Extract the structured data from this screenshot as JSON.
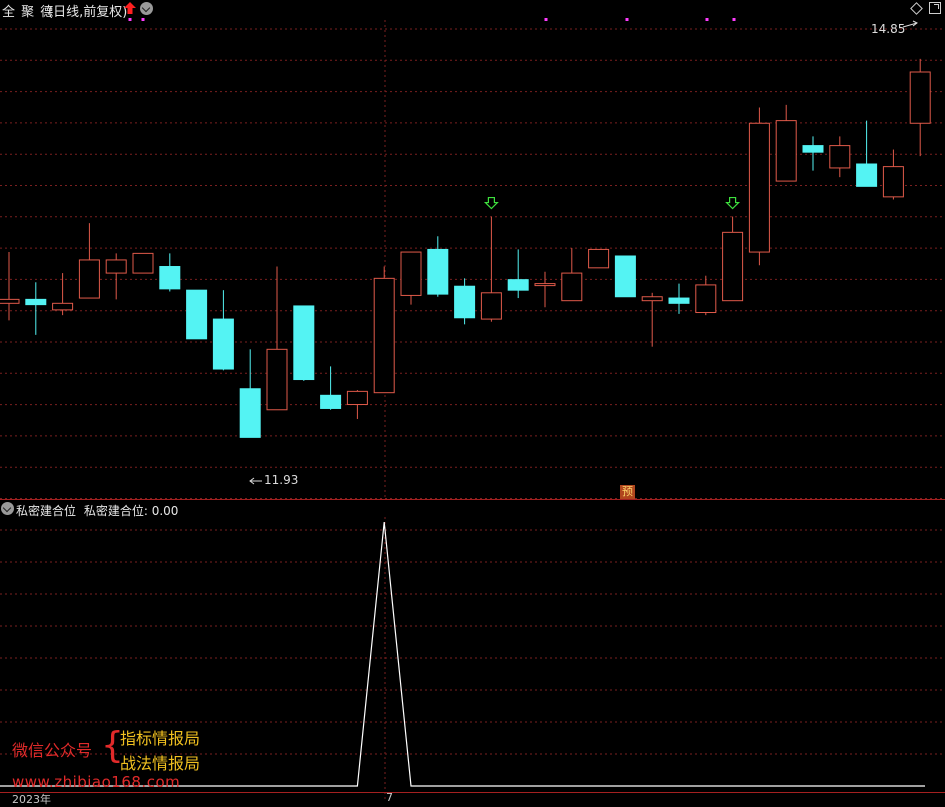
{
  "header": {
    "stock_name": "全 聚 德",
    "period": "(日线,前复权)",
    "colors": {
      "up": "#e05a4a",
      "down": "#54f3f3",
      "grid": "#7a1f1f",
      "axis": "#a52020"
    }
  },
  "price_panel": {
    "high_label": "14.85",
    "low_label": "11.93",
    "prediction_badge": "预"
  },
  "indicator": {
    "name": "私密建合位",
    "value_label": "私密建合位: 0.00"
  },
  "watermark": {
    "account": "微信公众号",
    "brace": "{",
    "line1": "指标情报局",
    "line2": "战法情报局",
    "url": "www.zhibiao168.com"
  },
  "x_axis": {
    "year_label": "2023年",
    "month_label": "7"
  },
  "chart_data": {
    "type": "candlestick",
    "price_range": [
      11.6,
      15.1
    ],
    "candles": [
      {
        "o": 12.99,
        "h": 13.38,
        "l": 12.86,
        "c": 13.02
      },
      {
        "o": 13.02,
        "h": 13.15,
        "l": 12.75,
        "c": 12.98
      },
      {
        "o": 12.94,
        "h": 13.22,
        "l": 12.9,
        "c": 12.99
      },
      {
        "o": 13.03,
        "h": 13.6,
        "l": 13.03,
        "c": 13.32
      },
      {
        "o": 13.22,
        "h": 13.37,
        "l": 13.02,
        "c": 13.32
      },
      {
        "o": 13.22,
        "h": 13.37,
        "l": 13.22,
        "c": 13.37
      },
      {
        "o": 13.27,
        "h": 13.37,
        "l": 13.08,
        "c": 13.1
      },
      {
        "o": 13.09,
        "h": 13.09,
        "l": 12.72,
        "c": 12.72
      },
      {
        "o": 12.87,
        "h": 13.09,
        "l": 12.48,
        "c": 12.49
      },
      {
        "o": 12.34,
        "h": 12.64,
        "l": 11.97,
        "c": 11.97
      },
      {
        "o": 12.18,
        "h": 13.27,
        "l": 12.18,
        "c": 12.64
      },
      {
        "o": 12.97,
        "h": 12.97,
        "l": 12.4,
        "c": 12.41
      },
      {
        "o": 12.29,
        "h": 12.51,
        "l": 12.18,
        "c": 12.19
      },
      {
        "o": 12.22,
        "h": 12.33,
        "l": 12.11,
        "c": 12.32
      },
      {
        "o": 12.31,
        "h": 13.27,
        "l": 12.31,
        "c": 13.18
      },
      {
        "o": 13.05,
        "h": 13.38,
        "l": 12.98,
        "c": 13.38
      },
      {
        "o": 13.4,
        "h": 13.5,
        "l": 13.04,
        "c": 13.06
      },
      {
        "o": 13.12,
        "h": 13.18,
        "l": 12.83,
        "c": 12.88
      },
      {
        "o": 12.87,
        "h": 13.65,
        "l": 12.85,
        "c": 13.07
      },
      {
        "o": 13.17,
        "h": 13.4,
        "l": 13.03,
        "c": 13.09
      },
      {
        "o": 13.14,
        "h": 13.23,
        "l": 12.96,
        "c": 13.14
      },
      {
        "o": 13.01,
        "h": 13.41,
        "l": 13.01,
        "c": 13.22
      },
      {
        "o": 13.26,
        "h": 13.37,
        "l": 13.26,
        "c": 13.4
      },
      {
        "o": 13.35,
        "h": 13.35,
        "l": 13.04,
        "c": 13.04
      },
      {
        "o": 13.01,
        "h": 13.07,
        "l": 12.66,
        "c": 13.04
      },
      {
        "o": 13.03,
        "h": 13.14,
        "l": 12.91,
        "c": 12.99
      },
      {
        "o": 12.92,
        "h": 13.2,
        "l": 12.9,
        "c": 13.13
      },
      {
        "o": 13.01,
        "h": 13.65,
        "l": 13.01,
        "c": 13.53
      },
      {
        "o": 13.38,
        "h": 14.48,
        "l": 13.28,
        "c": 14.36
      },
      {
        "o": 13.92,
        "h": 14.5,
        "l": 13.92,
        "c": 14.38
      },
      {
        "o": 14.19,
        "h": 14.26,
        "l": 14.0,
        "c": 14.14
      },
      {
        "o": 14.02,
        "h": 14.26,
        "l": 13.95,
        "c": 14.19
      },
      {
        "o": 14.05,
        "h": 14.38,
        "l": 13.95,
        "c": 13.88
      },
      {
        "o": 13.8,
        "h": 14.16,
        "l": 13.78,
        "c": 14.03
      },
      {
        "o": 14.36,
        "h": 14.85,
        "l": 14.11,
        "c": 14.75
      }
    ],
    "signals": [
      18,
      27
    ],
    "indicator_line": {
      "peak_index": 14,
      "peak_value": 1,
      "baseline": 0
    }
  }
}
